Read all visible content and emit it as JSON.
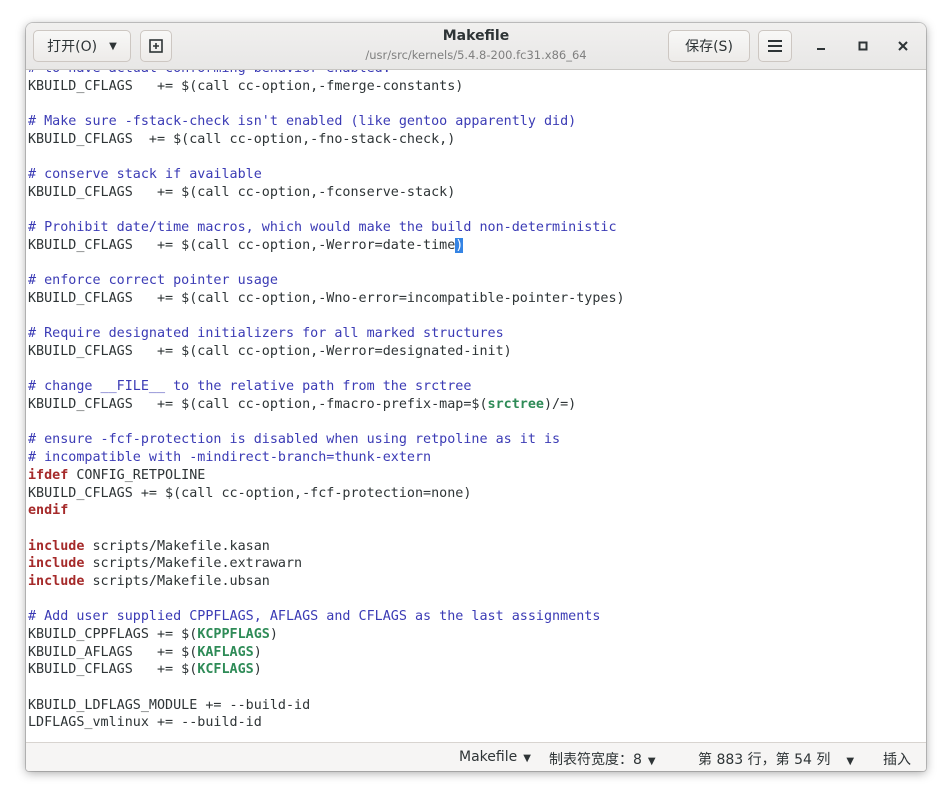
{
  "window": {
    "title": "Makefile",
    "subtitle": "/usr/src/kernels/5.4.8-200.fc31.x86_64"
  },
  "toolbar": {
    "open_label": "打开(O)",
    "new_tab_icon": "new-tab-icon",
    "save_label": "保存(S)",
    "menu_icon": "hamburger-menu-icon"
  },
  "editor": {
    "lines": [
      [
        [
          "c",
          "# to have actual conforming behavior enabled."
        ]
      ],
      [
        [
          "t",
          "KBUILD_CFLAGS   += $(call cc-option,-fmerge-constants)"
        ]
      ],
      [
        [
          "t",
          ""
        ]
      ],
      [
        [
          "c",
          "# Make sure -fstack-check isn't enabled (like gentoo apparently did)"
        ]
      ],
      [
        [
          "t",
          "KBUILD_CFLAGS  += $(call cc-option,-fno-stack-check,)"
        ]
      ],
      [
        [
          "t",
          ""
        ]
      ],
      [
        [
          "c",
          "# conserve stack if available"
        ]
      ],
      [
        [
          "t",
          "KBUILD_CFLAGS   += $(call cc-option,-fconserve-stack)"
        ]
      ],
      [
        [
          "t",
          ""
        ]
      ],
      [
        [
          "c",
          "# Prohibit date/time macros, which would make the build non-deterministic"
        ]
      ],
      [
        [
          "t",
          "KBUILD_CFLAGS   += $(call cc-option,-Werror=date-time"
        ],
        [
          "cur",
          ")"
        ]
      ],
      [
        [
          "t",
          ""
        ]
      ],
      [
        [
          "c",
          "# enforce correct pointer usage"
        ]
      ],
      [
        [
          "t",
          "KBUILD_CFLAGS   += $(call cc-option,-Wno-error=incompatible-pointer-types)"
        ]
      ],
      [
        [
          "t",
          ""
        ]
      ],
      [
        [
          "c",
          "# Require designated initializers for all marked structures"
        ]
      ],
      [
        [
          "t",
          "KBUILD_CFLAGS   += $(call cc-option,-Werror=designated-init)"
        ]
      ],
      [
        [
          "t",
          ""
        ]
      ],
      [
        [
          "c",
          "# change __FILE__ to the relative path from the srctree"
        ]
      ],
      [
        [
          "t",
          "KBUILD_CFLAGS   += $(call cc-option,-fmacro-prefix-map=$("
        ],
        [
          "v",
          "srctree"
        ],
        [
          "t",
          ")/=)"
        ]
      ],
      [
        [
          "t",
          ""
        ]
      ],
      [
        [
          "c",
          "# ensure -fcf-protection is disabled when using retpoline as it is"
        ]
      ],
      [
        [
          "c",
          "# incompatible with -mindirect-branch=thunk-extern"
        ]
      ],
      [
        [
          "k",
          "ifdef"
        ],
        [
          "t",
          " CONFIG_RETPOLINE"
        ]
      ],
      [
        [
          "t",
          "KBUILD_CFLAGS += $(call cc-option,-fcf-protection=none)"
        ]
      ],
      [
        [
          "k",
          "endif"
        ]
      ],
      [
        [
          "t",
          ""
        ]
      ],
      [
        [
          "k",
          "include"
        ],
        [
          "t",
          " scripts/Makefile.kasan"
        ]
      ],
      [
        [
          "k",
          "include"
        ],
        [
          "t",
          " scripts/Makefile.extrawarn"
        ]
      ],
      [
        [
          "k",
          "include"
        ],
        [
          "t",
          " scripts/Makefile.ubsan"
        ]
      ],
      [
        [
          "t",
          ""
        ]
      ],
      [
        [
          "c",
          "# Add user supplied CPPFLAGS, AFLAGS and CFLAGS as the last assignments"
        ]
      ],
      [
        [
          "t",
          "KBUILD_CPPFLAGS += $("
        ],
        [
          "v",
          "KCPPFLAGS"
        ],
        [
          "t",
          ")"
        ]
      ],
      [
        [
          "t",
          "KBUILD_AFLAGS   += $("
        ],
        [
          "v",
          "KAFLAGS"
        ],
        [
          "t",
          ")"
        ]
      ],
      [
        [
          "t",
          "KBUILD_CFLAGS   += $("
        ],
        [
          "v",
          "KCFLAGS"
        ],
        [
          "t",
          ")"
        ]
      ],
      [
        [
          "t",
          ""
        ]
      ],
      [
        [
          "t",
          "KBUILD_LDFLAGS_MODULE += --build-id"
        ]
      ],
      [
        [
          "t",
          "LDFLAGS_vmlinux += --build-id"
        ]
      ]
    ]
  },
  "statusbar": {
    "language": "Makefile",
    "tab_width": "制表符宽度：8",
    "position": "第 883 行，第 54 列",
    "insert_mode": "插入"
  }
}
